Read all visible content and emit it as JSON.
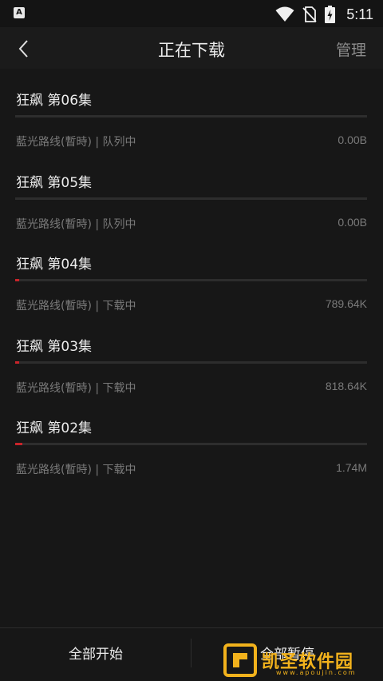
{
  "status_bar": {
    "app_icon_letter": "A",
    "time": "5:11"
  },
  "header": {
    "title": "正在下载",
    "manage_label": "管理"
  },
  "downloads": [
    {
      "name": "狂飙 第06集",
      "status": "藍光路线(暫時) | 队列中",
      "size": "0.00B",
      "progress": 0
    },
    {
      "name": "狂飙 第05集",
      "status": "藍光路线(暫時) | 队列中",
      "size": "0.00B",
      "progress": 0
    },
    {
      "name": "狂飙 第04集",
      "status": "藍光路线(暫時) | 下载中",
      "size": "789.64K",
      "progress": 0.012
    },
    {
      "name": "狂飙 第03集",
      "status": "藍光路线(暫時) | 下载中",
      "size": "818.64K",
      "progress": 0.012
    },
    {
      "name": "狂飙 第02集",
      "status": "藍光路线(暫時) | 下载中",
      "size": "1.74M",
      "progress": 0.02
    }
  ],
  "bottom_bar": {
    "start_all_label": "全部开始",
    "pause_all_label": "全部暂停"
  },
  "watermark": {
    "text": "凯圣软件园",
    "url": "www.apoujin.com"
  },
  "colors": {
    "background": "#171717",
    "progress_fill": "#c8242a",
    "progress_track": "#2d2d2d",
    "muted_text": "#7a7a7a",
    "watermark": "#f2b21c"
  }
}
